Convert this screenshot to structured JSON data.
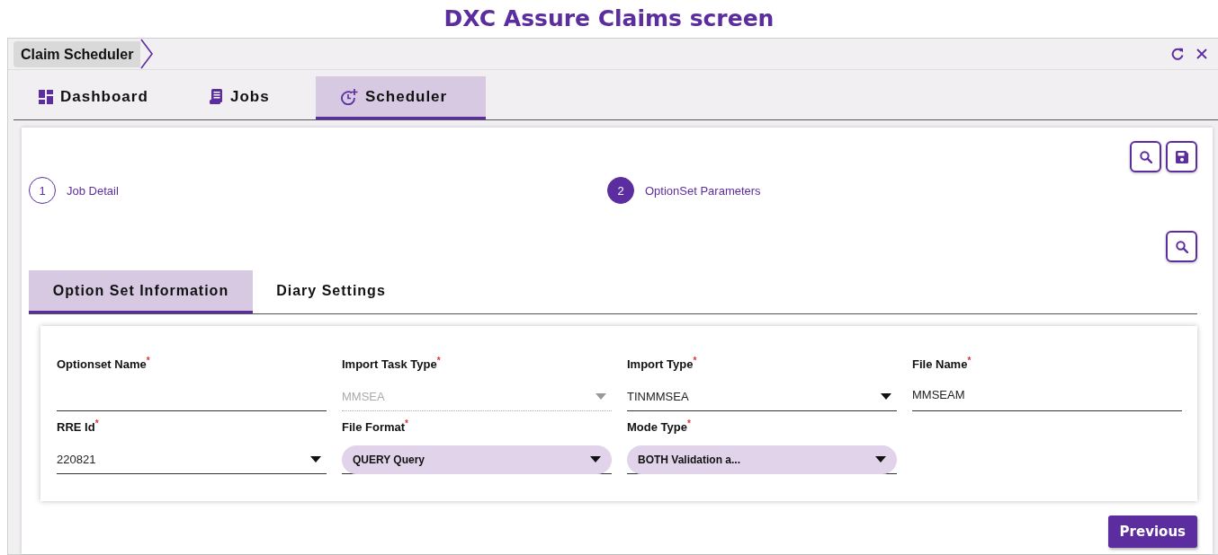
{
  "page_title": "DXC Assure Claims screen",
  "breadcrumb": "Claim Scheduler",
  "main_tabs": [
    {
      "label": "Dashboard",
      "kind": "dashboard",
      "selected": false
    },
    {
      "label": "Jobs",
      "kind": "jobs",
      "selected": false
    },
    {
      "label": "Scheduler",
      "kind": "scheduler",
      "selected": true
    }
  ],
  "steps": [
    {
      "number": "1",
      "label": "Job Detail",
      "selected": false
    },
    {
      "number": "2",
      "label": "OptionSet Parameters",
      "selected": true
    }
  ],
  "sub_tabs": [
    {
      "label": "Option Set Information",
      "selected": true
    },
    {
      "label": "Diary Settings",
      "selected": false
    }
  ],
  "fields": [
    {
      "label": "Optionset Name$^{*}$",
      "kind": "text",
      "disabled": false
    },
    {
      "label": "Import Task Type$^{*}$",
      "kind": "select",
      "value": "MMSEA",
      "disabled": true
    },
    {
      "label": "Import Type$^{*}$",
      "kind": "select",
      "value": "TINMMSEA",
      "disabled": false
    },
    {
      "label": "File Name$^{*}$",
      "kind": "text",
      "value": "MMSEAM",
      "disabled": false
    },
    {
      "label": "RRE Id$^{*}$",
      "kind": "select",
      "value": "220821",
      "disabled": false
    },
    {
      "label": "File Format$^{*}$",
      "kind": "pill",
      "value": "QUERY Query",
      "disabled": false
    },
    {
      "label": "Mode Type$^{*}$",
      "kind": "pill",
      "value": "BOTH Validation a...",
      "disabled": false
    }
  ],
  "previous_button": "Previous"
}
